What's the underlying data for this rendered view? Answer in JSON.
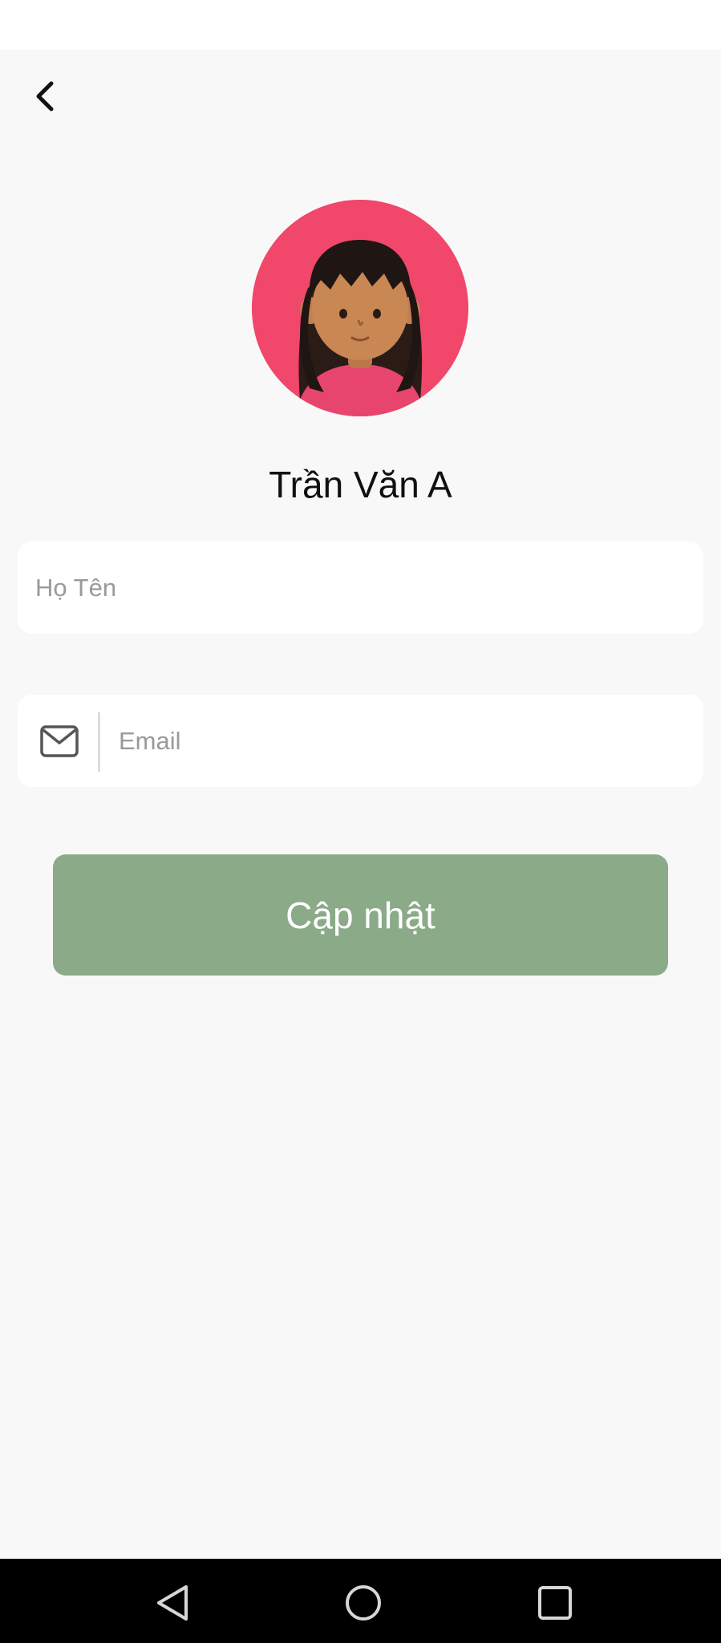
{
  "profile": {
    "name": "Trần Văn A",
    "avatar_icon": "cartoon-girl-avatar"
  },
  "form": {
    "name_placeholder": "Họ Tên",
    "name_value": "",
    "email_placeholder": "Email",
    "email_value": "",
    "email_icon": "envelope-icon"
  },
  "actions": {
    "update_label": "Cập nhật"
  },
  "colors": {
    "background": "#f9f8f9",
    "button": "#8aaa88",
    "avatar_background": "#f0476b",
    "nav_bar": "#000000"
  },
  "nav": {
    "icons": [
      "back-triangle-icon",
      "home-circle-icon",
      "recents-square-icon"
    ]
  }
}
